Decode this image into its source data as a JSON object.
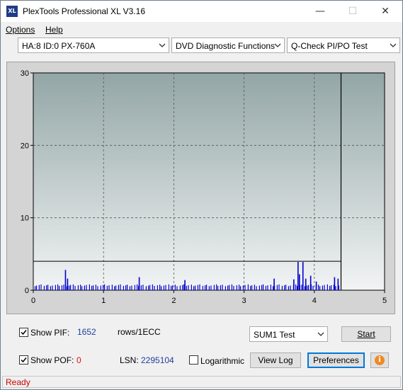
{
  "window": {
    "title": "PlexTools Professional XL V3.16",
    "icon_label": "XL"
  },
  "menu": {
    "items": [
      "Options",
      "Help"
    ]
  },
  "toolbar": {
    "drive_select": "HA:8 ID:0  PX-760A",
    "function_select": "DVD Diagnostic Functions",
    "test_select": "Q-Check PI/PO Test"
  },
  "chart_data": {
    "type": "bar",
    "x_ticks": [
      "0",
      "1",
      "2",
      "3",
      "4",
      "5"
    ],
    "y_ticks": [
      "0",
      "10",
      "20",
      "30"
    ],
    "xlim": [
      0,
      5
    ],
    "ylim": [
      0,
      30
    ],
    "grid": true,
    "threshold": 4,
    "end_marker_x": 4.38,
    "spikes": [
      {
        "x": 0.45,
        "y": 2.8
      },
      {
        "x": 0.48,
        "y": 1.6
      },
      {
        "x": 1.5,
        "y": 1.8
      },
      {
        "x": 2.15,
        "y": 1.4
      },
      {
        "x": 3.42,
        "y": 1.6
      },
      {
        "x": 3.7,
        "y": 1.5
      },
      {
        "x": 3.76,
        "y": 3.9
      },
      {
        "x": 3.78,
        "y": 2.2
      },
      {
        "x": 3.83,
        "y": 3.9
      },
      {
        "x": 3.87,
        "y": 1.6
      },
      {
        "x": 3.94,
        "y": 2.0
      },
      {
        "x": 4.02,
        "y": 1.2
      },
      {
        "x": 4.28,
        "y": 1.8
      },
      {
        "x": 4.33,
        "y": 1.6
      }
    ],
    "baseline_height": 0.8,
    "colors": {
      "bar": "#0000cc",
      "bg_top": "#93a6a6",
      "bg_bottom": "#f2f4f4"
    }
  },
  "controls": {
    "show_pif_label": "Show PIF:",
    "pif_value": "1652",
    "pif_unit": "rows/1ECC",
    "show_pof_label": "Show POF:",
    "pof_value": "0",
    "lsn_label": "LSN:",
    "lsn_value": "2295104",
    "logarithmic_label": "Logarithmic",
    "sum_select": "SUM1 Test",
    "start_label": "Start",
    "view_log_label": "View Log",
    "preferences_label": "Preferences",
    "info_glyph": "i"
  },
  "status": {
    "text": "Ready"
  }
}
